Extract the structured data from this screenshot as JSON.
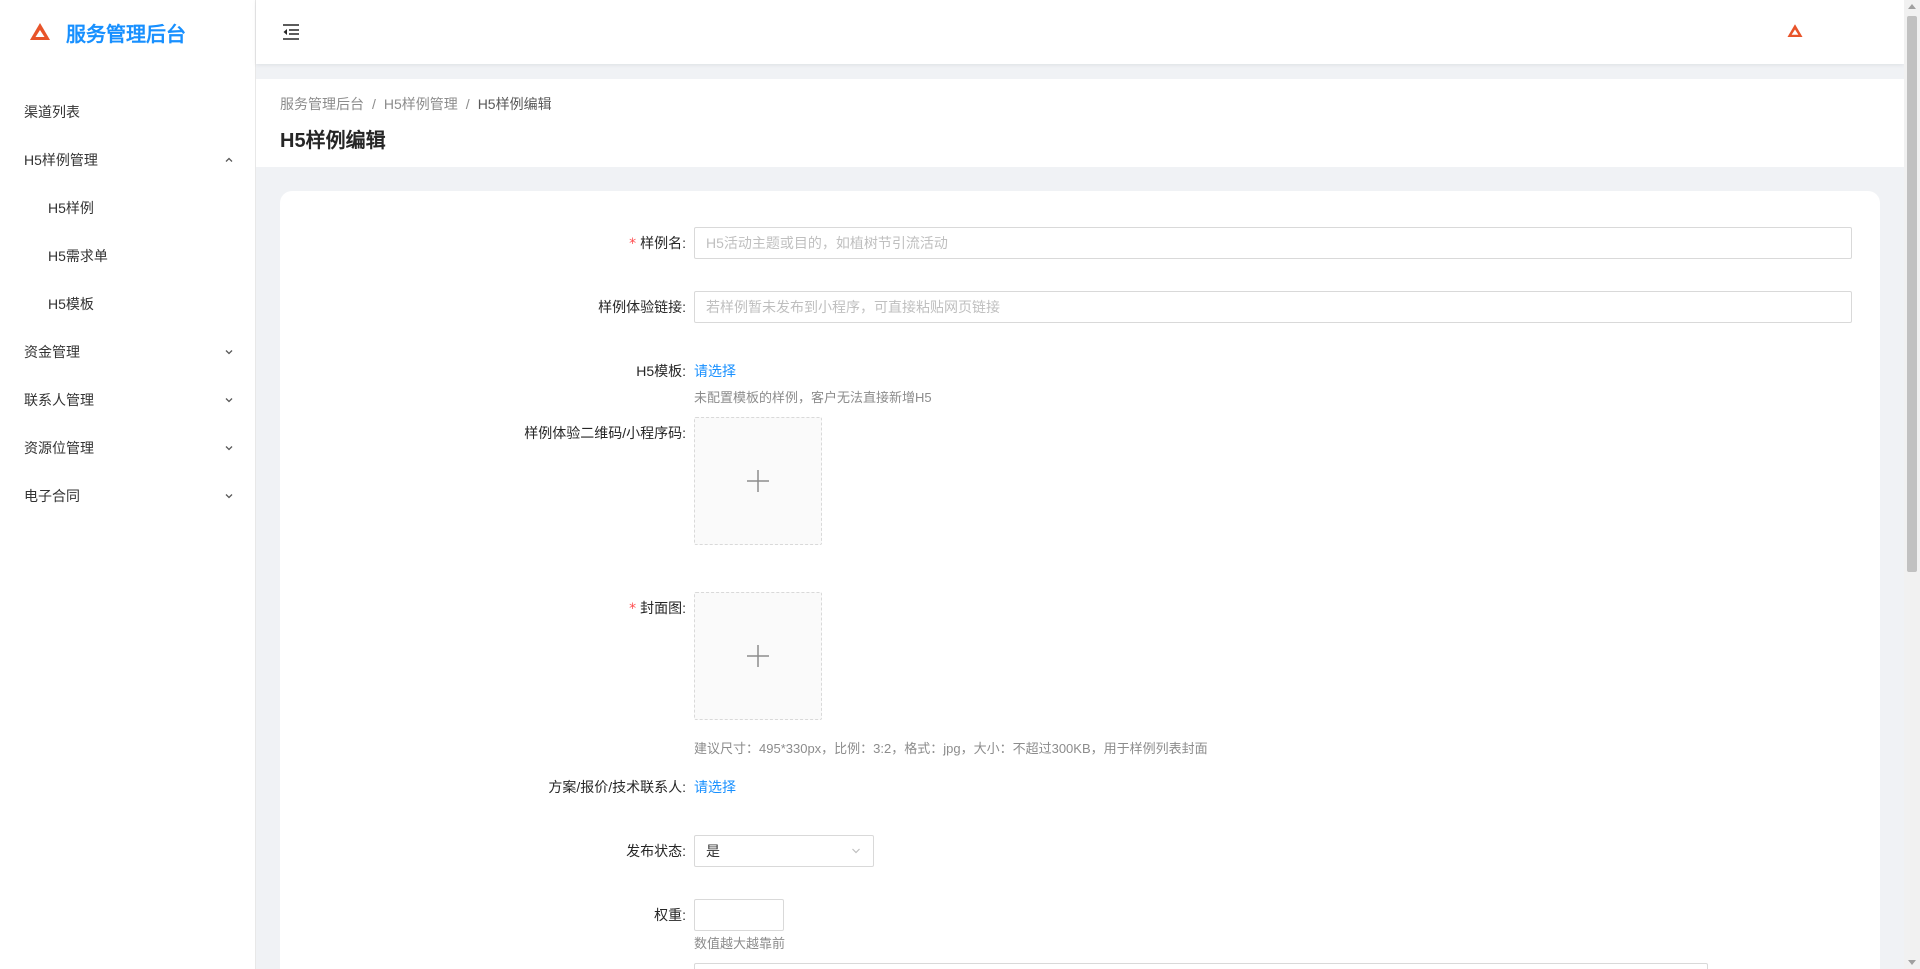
{
  "app": {
    "title": "服务管理后台",
    "accent": "#1890ff",
    "logo_color": "#e8542a"
  },
  "sidebar": {
    "items": [
      {
        "label": "渠道列表",
        "level": 1
      },
      {
        "label": "H5样例管理",
        "level": 1,
        "expanded": true
      },
      {
        "label": "H5样例",
        "level": 2
      },
      {
        "label": "H5需求单",
        "level": 2
      },
      {
        "label": "H5模板",
        "level": 2
      },
      {
        "label": "资金管理",
        "level": 1,
        "expanded": false
      },
      {
        "label": "联系人管理",
        "level": 1,
        "expanded": false
      },
      {
        "label": "资源位管理",
        "level": 1,
        "expanded": false
      },
      {
        "label": "电子合同",
        "level": 1,
        "expanded": false
      }
    ]
  },
  "header": {
    "fold_icon": "menu-fold-icon"
  },
  "breadcrumb": {
    "items": [
      "服务管理后台",
      "H5样例管理",
      "H5样例编辑"
    ],
    "separator": "/"
  },
  "page": {
    "title": "H5样例编辑"
  },
  "form": {
    "name": {
      "label": "样例名:",
      "required": "*",
      "placeholder": "H5活动主题或目的，如植树节引流活动"
    },
    "experience_link": {
      "label": "样例体验链接:",
      "placeholder": "若样例暂未发布到小程序，可直接粘贴网页链接"
    },
    "template": {
      "label": "H5模板:",
      "action": "请选择",
      "hint": "未配置模板的样例，客户无法直接新增H5"
    },
    "qrcode": {
      "label": "样例体验二维码/小程序码:"
    },
    "cover": {
      "label": "封面图:",
      "required": "*",
      "hint": "建议尺寸：495*330px，比例：3:2，格式：jpg，大小：不超过300KB，用于样例列表封面"
    },
    "contact": {
      "label": "方案/报价/技术联系人:",
      "action": "请选择"
    },
    "publish": {
      "label": "发布状态:",
      "value": "是"
    },
    "weight": {
      "label": "权重:",
      "value": "",
      "hint": "数值越大越靠前"
    }
  }
}
